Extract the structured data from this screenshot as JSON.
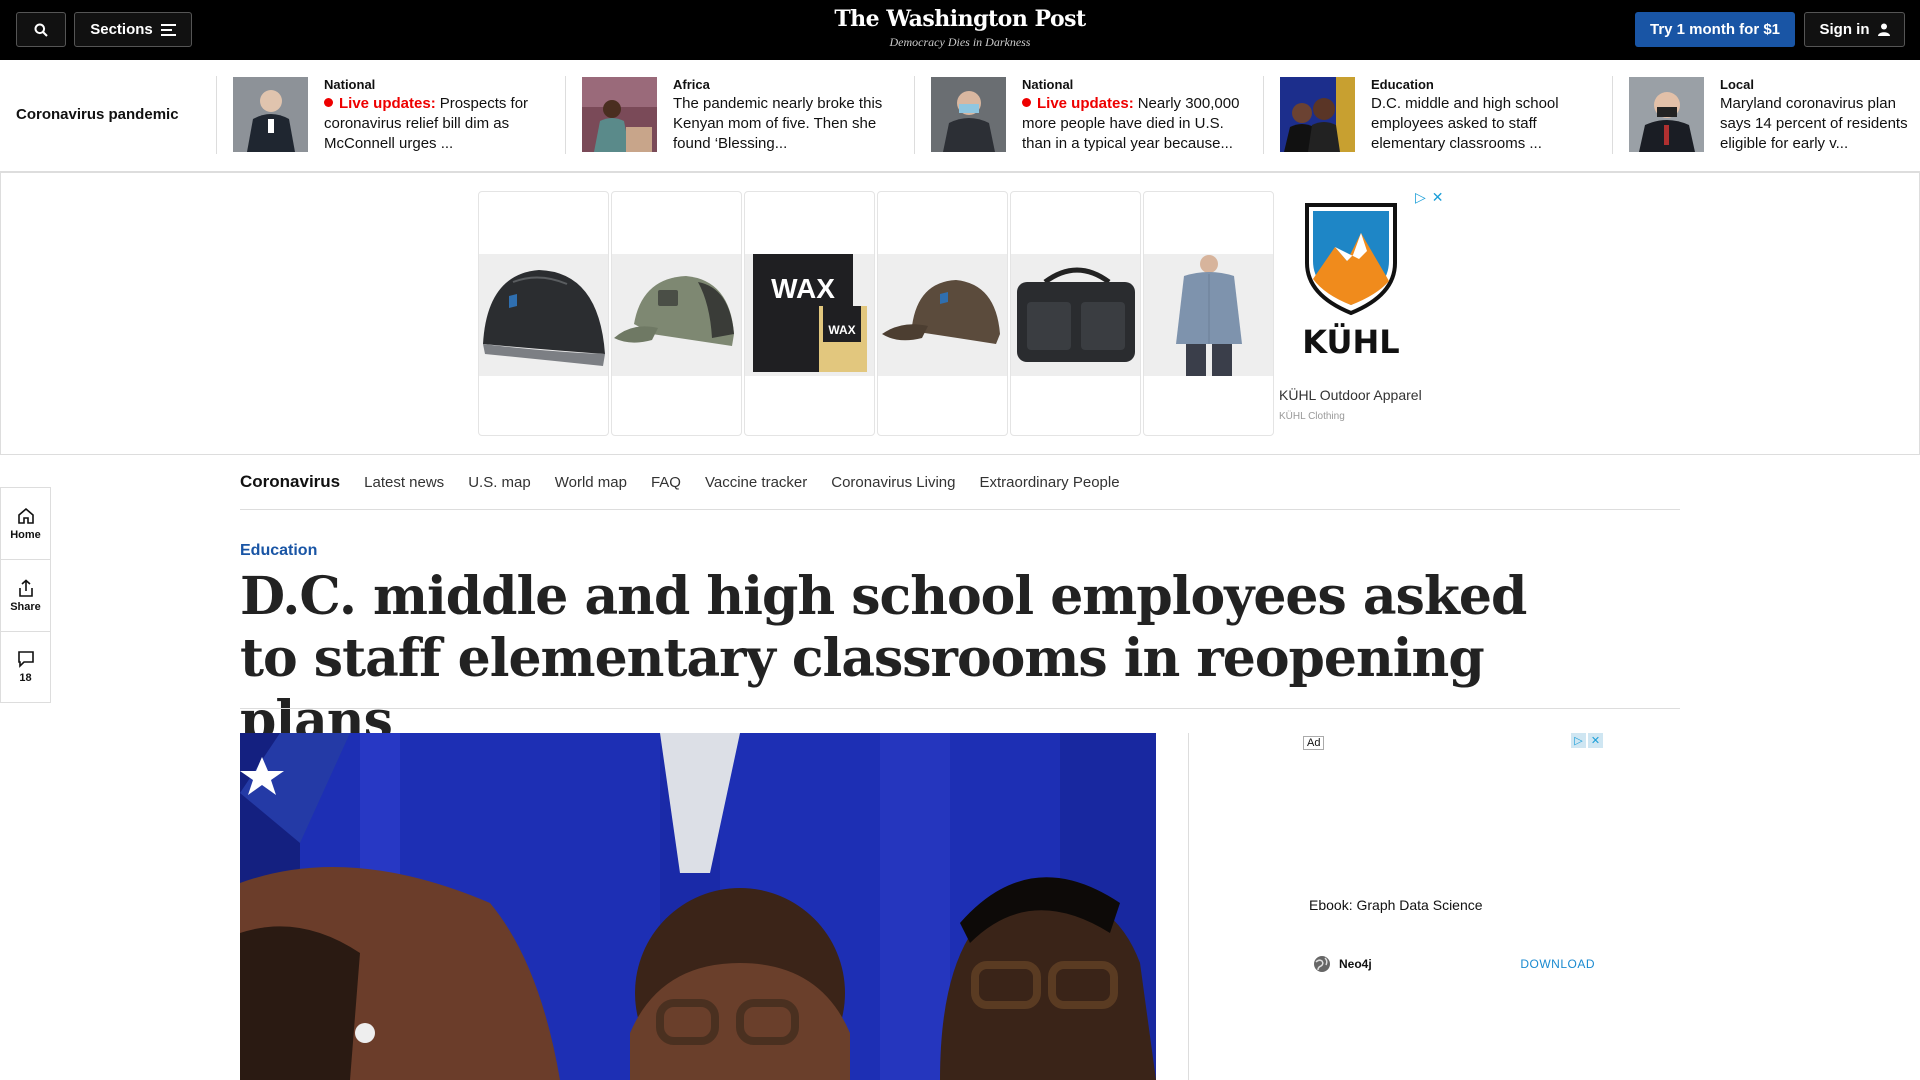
{
  "header": {
    "sections_label": "Sections",
    "logo": "The Washington Post",
    "tagline": "Democracy Dies in Darkness",
    "trial_label": "Try 1 month for $1",
    "signin_label": "Sign in"
  },
  "strip": {
    "label": "Coronavirus pandemic",
    "stories": [
      {
        "kicker": "National",
        "live": "Live updates:",
        "text": "Prospects for coronavirus relief bill dim as McConnell urges ..."
      },
      {
        "kicker": "Africa",
        "live": "",
        "text": "The pandemic nearly broke this Kenyan mom of five. Then she found ‘Blessing..."
      },
      {
        "kicker": "National",
        "live": "Live updates:",
        "text": "Nearly 300,000 more people have died in U.S. than in a typical year because..."
      },
      {
        "kicker": "Education",
        "live": "",
        "text": "D.C. middle and high school employees asked to staff elementary classrooms ..."
      },
      {
        "kicker": "Local",
        "live": "",
        "text": "Maryland coronavirus plan says 14 percent of residents eligible for early v..."
      }
    ]
  },
  "banner_ad": {
    "products": [
      "beanie",
      "trucker-cap",
      "wax-bar",
      "brown-cap",
      "duffel-bag",
      "button-shirt"
    ],
    "advertiser": "KÜHL Outdoor Apparel",
    "sponsor": "KÜHL Clothing",
    "logo_text": "KÜHL"
  },
  "rail": {
    "home_label": "Home",
    "share_label": "Share",
    "comments_count": "18"
  },
  "subnav": {
    "brand": "Coronavirus",
    "links": [
      "Latest news",
      "U.S. map",
      "World map",
      "FAQ",
      "Vaccine tracker",
      "Coronavirus Living",
      "Extraordinary People"
    ]
  },
  "article": {
    "kicker": "Education",
    "headline": "D.C. middle and high school employees asked to staff elementary classrooms in reopening plans"
  },
  "side_ad": {
    "label": "Ad",
    "title": "Ebook: Graph Data Science",
    "brand": "Neo4j",
    "cta": "DOWNLOAD"
  },
  "colors": {
    "accent": "#1955a5",
    "live": "#e00000",
    "photo_backdrop": "#1a2cae"
  }
}
